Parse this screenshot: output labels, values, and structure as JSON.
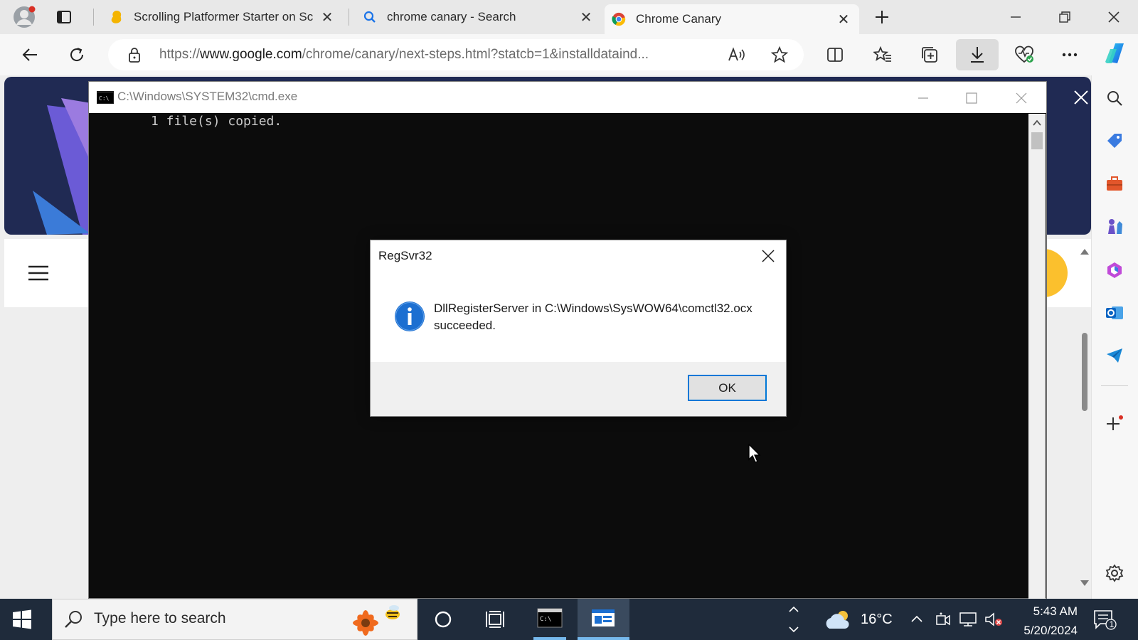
{
  "browser": {
    "tabs": [
      {
        "title": "Scrolling Platformer Starter on Sc",
        "active": false
      },
      {
        "title": "chrome canary - Search",
        "active": false
      },
      {
        "title": "Chrome Canary",
        "active": true
      }
    ],
    "address_bar": {
      "url_prefix": "https://",
      "url_domain": "www.google.com",
      "url_path": "/chrome/canary/next-steps.html?statcb=1&installdataind..."
    }
  },
  "cmd_window": {
    "title": "C:\\Windows\\SYSTEM32\\cmd.exe",
    "output": "1 file(s) copied."
  },
  "dialog": {
    "title": "RegSvr32",
    "message_line1": "DllRegisterServer in C:\\Windows\\SysWOW64\\comctl32.ocx",
    "message_line2": "succeeded.",
    "ok_label": "OK",
    "icon": "info-icon"
  },
  "taskbar": {
    "search_placeholder": "Type here to search",
    "weather_temp": "16°C",
    "time": "5:43 AM",
    "date": "5/20/2024",
    "notification_count": "1"
  },
  "colors": {
    "accent": "#0078d7",
    "taskbar": "#1f2b3b",
    "cmd_bg": "#0c0c0c"
  }
}
